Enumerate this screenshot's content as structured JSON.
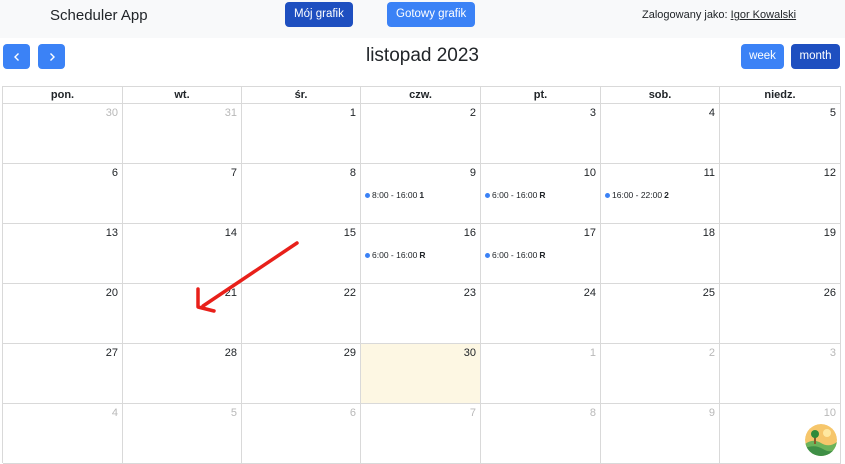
{
  "navbar": {
    "brand": "Scheduler App",
    "my_schedule": "Mój grafik",
    "ready_schedule": "Gotowy grafik",
    "logged_in_label": "Zalogowany jako:",
    "user_name": "Igor Kowalski"
  },
  "calendar": {
    "title": "listopad 2023",
    "prev_icon": "chevron-left-icon",
    "next_icon": "chevron-right-icon",
    "view_week": "week",
    "view_month": "month",
    "active_view": "month",
    "weekdays": [
      "pon.",
      "wt.",
      "śr.",
      "czw.",
      "pt.",
      "sob.",
      "niedz."
    ],
    "weeks": [
      [
        {
          "day": "30",
          "other": true
        },
        {
          "day": "31",
          "other": true
        },
        {
          "day": "1"
        },
        {
          "day": "2"
        },
        {
          "day": "3"
        },
        {
          "day": "4"
        },
        {
          "day": "5"
        }
      ],
      [
        {
          "day": "6"
        },
        {
          "day": "7"
        },
        {
          "day": "8"
        },
        {
          "day": "9",
          "event": {
            "time": "8:00 - 16:00",
            "tag": "1"
          }
        },
        {
          "day": "10",
          "event": {
            "time": "6:00 - 16:00",
            "tag": "R"
          }
        },
        {
          "day": "11",
          "event": {
            "time": "16:00 - 22:00",
            "tag": "2"
          }
        },
        {
          "day": "12"
        }
      ],
      [
        {
          "day": "13"
        },
        {
          "day": "14"
        },
        {
          "day": "15"
        },
        {
          "day": "16",
          "event": {
            "time": "6:00 - 16:00",
            "tag": "R"
          }
        },
        {
          "day": "17",
          "event": {
            "time": "6:00 - 16:00",
            "tag": "R"
          }
        },
        {
          "day": "18"
        },
        {
          "day": "19"
        }
      ],
      [
        {
          "day": "20"
        },
        {
          "day": "21"
        },
        {
          "day": "22"
        },
        {
          "day": "23"
        },
        {
          "day": "24"
        },
        {
          "day": "25"
        },
        {
          "day": "26"
        }
      ],
      [
        {
          "day": "27"
        },
        {
          "day": "28"
        },
        {
          "day": "29"
        },
        {
          "day": "30",
          "today": true
        },
        {
          "day": "1",
          "other": true
        },
        {
          "day": "2",
          "other": true
        },
        {
          "day": "3",
          "other": true
        }
      ],
      [
        {
          "day": "4",
          "other": true
        },
        {
          "day": "5",
          "other": true
        },
        {
          "day": "6",
          "other": true
        },
        {
          "day": "7",
          "other": true
        },
        {
          "day": "8",
          "other": true
        },
        {
          "day": "9",
          "other": true
        },
        {
          "day": "10",
          "other": true
        }
      ]
    ]
  },
  "annotation": {
    "arrow_icon": "red-arrow-icon",
    "color": "#e8201a"
  },
  "colors": {
    "primary": "#3b82f6",
    "primary_dark": "#1e4fc0",
    "today_bg": "#fdf7e3",
    "navbar_bg": "#f8f9fa"
  },
  "badge_icon": "landscape-avatar-icon"
}
